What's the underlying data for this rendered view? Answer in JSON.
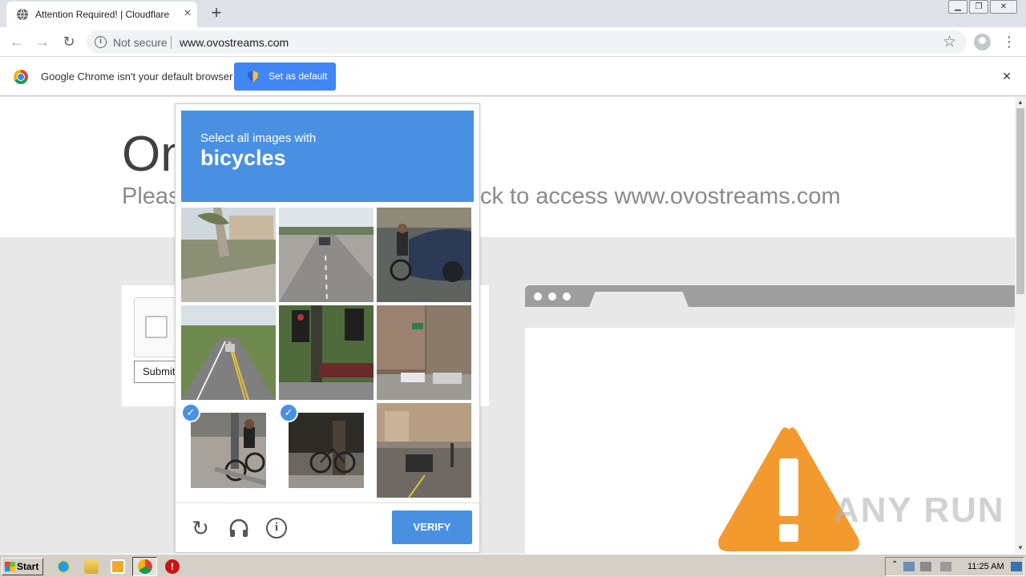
{
  "browser": {
    "tab_title": "Attention Required! | Cloudflare",
    "tab_close": "×",
    "new_tab": "+",
    "security_label": "Not secure",
    "url": "www.ovostreams.com"
  },
  "infobar": {
    "message": "Google Chrome isn't your default browser",
    "set_default_label": "Set as default",
    "close": "×"
  },
  "page": {
    "heading_partial": "On",
    "subheading_left": "Pleas",
    "subheading_right": "ck to access www.ovostreams.com",
    "submit_label": "Submit"
  },
  "captcha": {
    "instruction": "Select all images with",
    "target": "bicycles",
    "verify_label": "VERIFY",
    "tiles": [
      {
        "id": 1,
        "selected": false
      },
      {
        "id": 2,
        "selected": false
      },
      {
        "id": 3,
        "selected": false
      },
      {
        "id": 4,
        "selected": false
      },
      {
        "id": 5,
        "selected": false
      },
      {
        "id": 6,
        "selected": false
      },
      {
        "id": 7,
        "selected": true
      },
      {
        "id": 8,
        "selected": true
      },
      {
        "id": 9,
        "selected": false
      }
    ],
    "colors": {
      "header": "#4a90e2",
      "button": "#4a90e2"
    }
  },
  "watermark": "ANY RUN",
  "taskbar": {
    "start_label": "Start",
    "clock": "11:25 AM"
  },
  "icons": [
    "globe-icon",
    "info-icon",
    "star-icon",
    "profile-icon",
    "menu-icon",
    "chrome-logo-icon",
    "shield-icon",
    "reload-icon",
    "headphones-icon",
    "warning-icon",
    "ie-icon",
    "folder-icon",
    "media-icon",
    "stop-icon"
  ]
}
